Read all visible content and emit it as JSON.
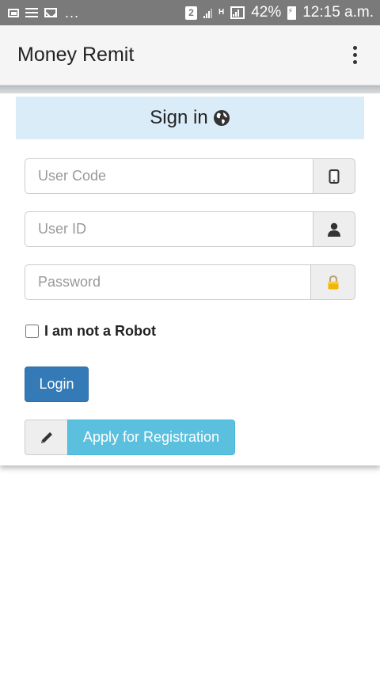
{
  "status_bar": {
    "left_dots": "...",
    "sim_label": "2",
    "network_type": "H",
    "battery": "42%",
    "time": "12:15 a.m."
  },
  "app_bar": {
    "title": "Money Remit",
    "menu_icon": "overflow-menu-icon"
  },
  "signin": {
    "title": "Sign in",
    "title_icon": "globe-icon",
    "header_color": "#d9ecf7"
  },
  "form": {
    "user_code": {
      "placeholder": "User Code",
      "value": "",
      "icon": "mobile-phone-icon"
    },
    "user_id": {
      "placeholder": "User ID",
      "value": "",
      "icon": "user-icon"
    },
    "password": {
      "placeholder": "Password",
      "value": "",
      "icon": "lock-icon"
    },
    "robot_checkbox": {
      "label": "I am not a Robot",
      "checked": false
    },
    "login_label": "Login",
    "registration": {
      "icon": "pencil-icon",
      "label": "Apply for Registration"
    }
  },
  "colors": {
    "primary_button": "#337ab7",
    "info_button": "#5bc0de",
    "status_bar": "#7a7a7a"
  }
}
